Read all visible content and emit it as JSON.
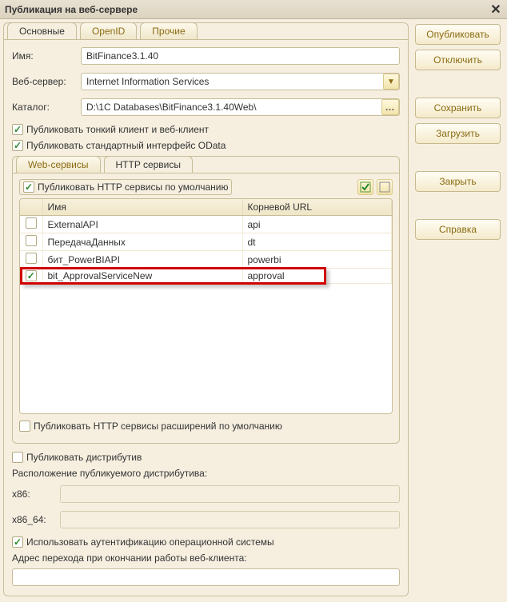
{
  "window": {
    "title": "Публикация на веб-сервере"
  },
  "buttons": {
    "publish": "Опубликовать",
    "disconnect": "Отключить",
    "save": "Сохранить",
    "load": "Загрузить",
    "close": "Закрыть",
    "help": "Справка"
  },
  "tabs_outer": {
    "main": "Основные",
    "openid": "OpenID",
    "other": "Прочие"
  },
  "form": {
    "name_label": "Имя:",
    "name_value": "BitFinance3.1.40",
    "server_label": "Веб-сервер:",
    "server_value": "Internet Information Services",
    "catalog_label": "Каталог:",
    "catalog_value": "D:\\1C Databases\\BitFinance3.1.40Web\\"
  },
  "checks": {
    "thin_client": "Публиковать тонкий клиент и веб-клиент",
    "odata": "Публиковать стандартный интерфейс OData",
    "http_default": "Публиковать HTTP сервисы по умолчанию",
    "http_ext_default": "Публиковать HTTP сервисы расширений по умолчанию",
    "distrib": "Публиковать дистрибутив",
    "os_auth": "Использовать аутентификацию операционной системы"
  },
  "tabs_inner": {
    "ws": "Web-сервисы",
    "http": "HTTP сервисы"
  },
  "table": {
    "col_name": "Имя",
    "col_url": "Корневой URL",
    "rows": [
      {
        "checked": false,
        "name": "ExternalAPI",
        "url": "api"
      },
      {
        "checked": false,
        "name": "ПередачаДанных",
        "url": "dt"
      },
      {
        "checked": false,
        "name": "бит_PowerBIAPI",
        "url": "powerbi"
      },
      {
        "checked": true,
        "name": "bit_ApprovalServiceNew",
        "url": "approval"
      }
    ]
  },
  "labels": {
    "distrib_location": "Расположение публикуемого дистрибутива:",
    "x86": "x86:",
    "x86_64": "x86_64:",
    "redirect": "Адрес перехода при окончании работы веб-клиента:"
  }
}
